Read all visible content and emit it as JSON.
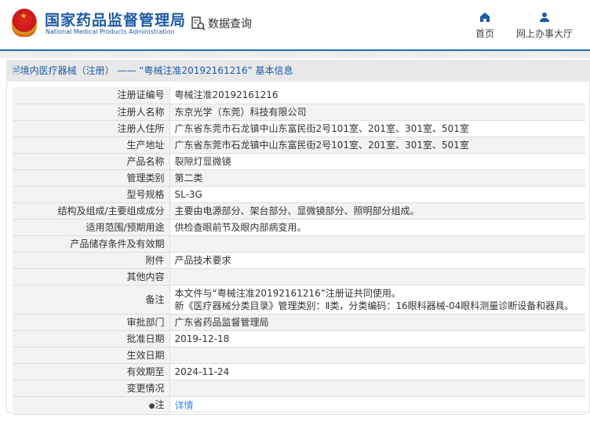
{
  "header": {
    "brand_cn": "国家药品监督管理局",
    "brand_en": "National Medical Products Administration",
    "query_label": "数据查询",
    "nav": [
      {
        "label": "首页",
        "icon": "home-icon"
      },
      {
        "label": "网上办事大厅",
        "icon": "user-icon"
      }
    ]
  },
  "title": "境内医疗器械（注册） —— “粤械注准20192161216” 基本信息",
  "rows": [
    {
      "label": "注册证编号",
      "value": "粤械注准20192161216"
    },
    {
      "label": "注册人名称",
      "value": "东京光学（东莞）科技有限公司"
    },
    {
      "label": "注册人住所",
      "value": "广东省东莞市石龙镇中山东富民街2号101室、201室、301室、501室"
    },
    {
      "label": "生产地址",
      "value": "广东省东莞市石龙镇中山东富民街2号101室、201室、301室、501室"
    },
    {
      "label": "产品名称",
      "value": "裂隙灯显微镜"
    },
    {
      "label": "管理类别",
      "value": "第二类"
    },
    {
      "label": "型号规格",
      "value": "SL-3G"
    },
    {
      "label": "结构及组成/主要组成成分",
      "value": "主要由电源部分、架台部分、显微镜部分、照明部分组成。"
    },
    {
      "label": "适用范围/预期用途",
      "value": "供检查眼前节及眼内部病变用。"
    },
    {
      "label": "产品储存条件及有效期",
      "value": ""
    },
    {
      "label": "附件",
      "value": "产品技术要求"
    },
    {
      "label": "其他内容",
      "value": ""
    },
    {
      "label": "备注",
      "value": "本文件与“粤械注准20192161216”注册证共同使用。",
      "value2": "新《医疗器械分类目录》管理类别：Ⅱ类，分类编码：16眼科器械-04眼科测量诊断设备和器具。"
    },
    {
      "label": "审批部门",
      "value": "广东省药品监督管理局"
    },
    {
      "label": "批准日期",
      "value": "2019-12-18"
    },
    {
      "label": "生效日期",
      "value": ""
    },
    {
      "label": "有效期至",
      "value": "2024-11-24"
    },
    {
      "label": "变更情况",
      "value": ""
    },
    {
      "label": "注",
      "value": "详情"
    }
  ]
}
